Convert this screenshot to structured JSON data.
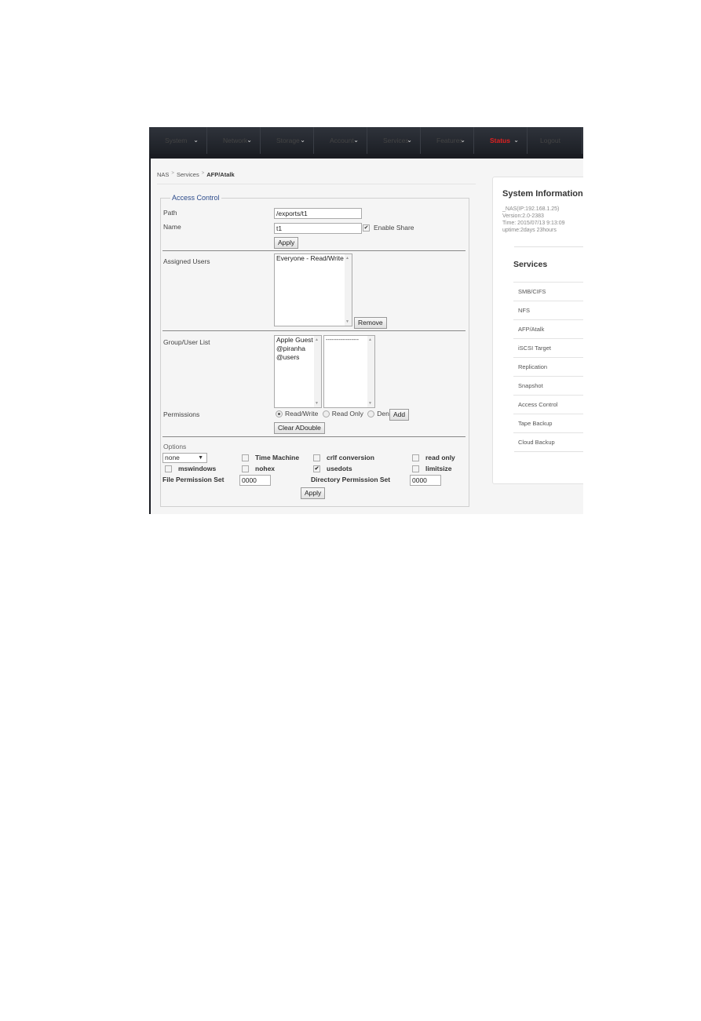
{
  "nav": {
    "items": [
      {
        "label": "System",
        "has_dropdown": true
      },
      {
        "label": "Network",
        "has_dropdown": true
      },
      {
        "label": "Storage",
        "has_dropdown": true
      },
      {
        "label": "Account",
        "has_dropdown": true
      },
      {
        "label": "Services",
        "has_dropdown": true
      },
      {
        "label": "Features",
        "has_dropdown": true
      },
      {
        "label": "Status",
        "has_dropdown": true,
        "highlight_color": "#e02020"
      },
      {
        "label": "Logout",
        "has_dropdown": false
      }
    ]
  },
  "breadcrumb": [
    "NAS",
    "Services",
    "AFP/Atalk"
  ],
  "access_control": {
    "legend": "Access Control",
    "path_label": "Path",
    "path_value": "/exports/t1",
    "name_label": "Name",
    "name_value": "t1",
    "enable_share_label": "Enable Share",
    "enable_share_checked": true,
    "apply_label": "Apply",
    "assigned_users_label": "Assigned Users",
    "assigned_users": [
      "Everyone - Read/Write"
    ],
    "remove_label": "Remove",
    "group_user_list_label": "Group/User List",
    "group_user_list": [
      "Apple Guest",
      "@piranha",
      "@users"
    ],
    "second_list": [
      "------------------"
    ],
    "permissions_label": "Permissions",
    "permission_options": [
      "Read/Write",
      "Read Only",
      "Deny"
    ],
    "permission_selected": "Read/Write",
    "add_label": "Add",
    "clear_label": "Clear ADouble",
    "options_label": "Options",
    "options_select_value": "none",
    "options": {
      "time_machine": {
        "label": "Time Machine",
        "checked": false
      },
      "crlf_conversion": {
        "label": "crlf conversion",
        "checked": false
      },
      "read_only": {
        "label": "read only",
        "checked": false
      },
      "mswindows": {
        "label": "mswindows",
        "checked": false
      },
      "nohex": {
        "label": "nohex",
        "checked": false
      },
      "usedots": {
        "label": "usedots",
        "checked": true
      },
      "limitsize": {
        "label": "limitsize",
        "checked": false
      }
    },
    "file_perm_label": "File Permission Set",
    "file_perm_value": "0000",
    "dir_perm_label": "Directory Permission Set",
    "dir_perm_value": "0000",
    "apply2_label": "Apply"
  },
  "system_info": {
    "title": "System Information",
    "lines": [
      "_NAS(IP:192.168.1.25)",
      "Version:2.0-2383",
      "Time: 2015/07/13 9:13:09",
      "uptime:2days 23hours"
    ]
  },
  "services": {
    "title": "Services",
    "items": [
      "SMB/CIFS",
      "NFS",
      "AFP/Atalk",
      "iSCSI Target",
      "Replication",
      "Snapshot",
      "Access Control",
      "Tape Backup",
      "Cloud Backup"
    ]
  }
}
